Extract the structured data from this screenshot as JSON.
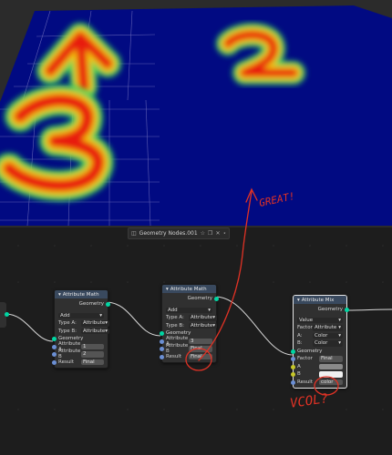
{
  "viewport": {
    "labels": [
      "1",
      "2",
      "3"
    ],
    "colors": {
      "background": "#2b2b2b",
      "plane": "#010a82",
      "hot": "#e81a0a",
      "mid": "#f2c80c",
      "cool": "#2bd05a",
      "grid": "#7d7bc4"
    }
  },
  "editor_header": {
    "tree_name": "Geometry Nodes.001",
    "icons": [
      "node-tree-icon",
      "fake-user-icon",
      "copy-icon",
      "close-icon",
      "pin-icon"
    ]
  },
  "nodes": {
    "math1": {
      "title": "Attribute Math",
      "output": "Geometry",
      "operation": "Add",
      "type_a_label": "Type A:",
      "type_a": "Attribute",
      "type_b_label": "Type B:",
      "type_b": "Attribute",
      "geometry": "Geometry",
      "attr_a_label": "Attribute A",
      "attr_a": "1",
      "attr_b_label": "Attribute B",
      "attr_b": "2",
      "result_label": "Result",
      "result": "Final"
    },
    "math2": {
      "title": "Attribute Math",
      "output": "Geometry",
      "operation": "Add",
      "type_a_label": "Type A:",
      "type_a": "Attribute",
      "type_b_label": "Type B:",
      "type_b": "Attribute",
      "geometry": "Geometry",
      "attr_a_label": "Attribute A",
      "attr_a": "3",
      "attr_b_label": "Attribute B",
      "attr_b": "Final",
      "result_label": "Result",
      "result": "Final"
    },
    "mix": {
      "title": "Attribute Mix",
      "output": "Geometry",
      "blend": "Value",
      "factor_label": "Factor",
      "factor_type": "Attribute",
      "a_label": "A:",
      "a_type": "Color",
      "b_label": "B:",
      "b_type": "Color",
      "geometry": "Geometry",
      "factor_socket": "Factor",
      "factor_value": "Final",
      "a_socket": "A",
      "b_socket": "B",
      "result_label": "Result",
      "result": "color"
    }
  },
  "annotations": {
    "great": "GREAT!",
    "vcol": "VCOL?",
    "color": "#e03225"
  }
}
